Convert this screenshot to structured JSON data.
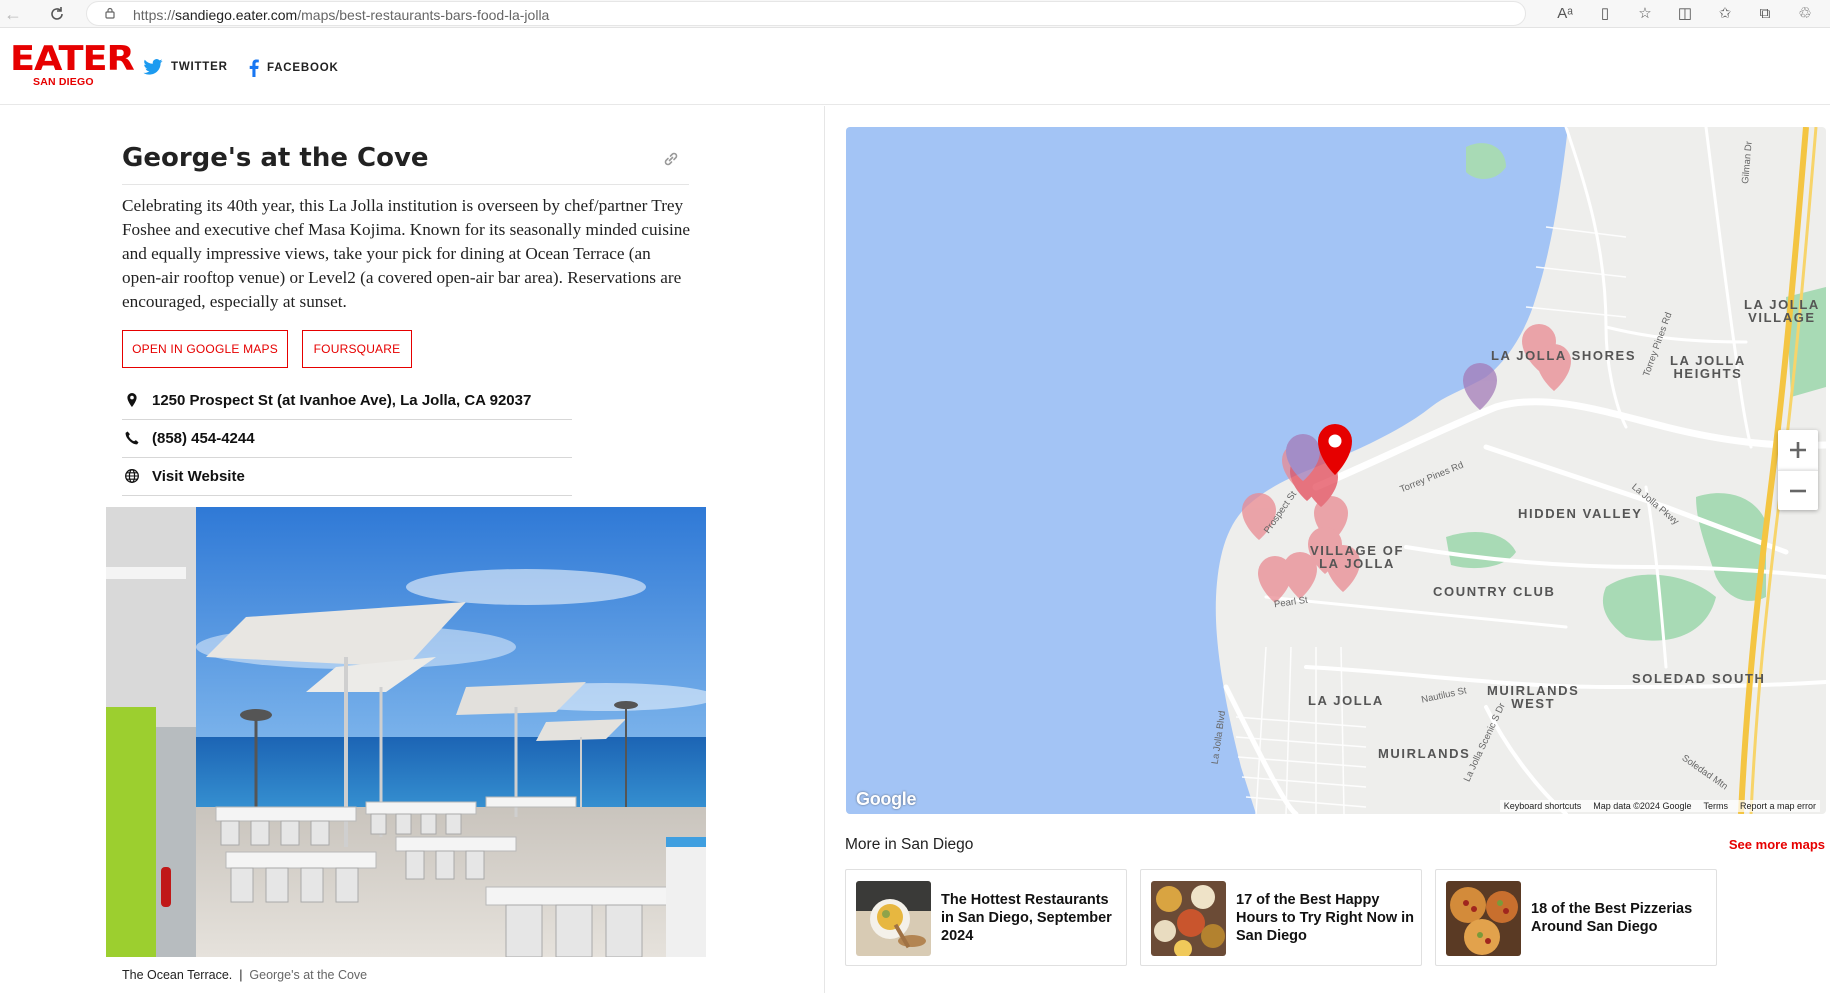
{
  "browser": {
    "url_host": "sandiego.eater.com",
    "url_path": "/maps/best-restaurants-bars-food-la-jolla",
    "url_scheme": "https://"
  },
  "header": {
    "logo": "EATER",
    "city": "SAN DIEGO",
    "twitter_label": "TWITTER",
    "facebook_label": "FACEBOOK"
  },
  "venue": {
    "title": "George's at the Cove",
    "description": "Celebrating its 40th year, this La Jolla institution is overseen by chef/partner Trey Foshee and executive chef Masa Kojima. Known for its seasonally minded cuisine and equally impressive views, take your pick for dining at Ocean Terrace (an open-air rooftop venue) or Level2 (a covered open-air bar area). Reservations are encouraged, especially at sunset.",
    "buttons": {
      "google_maps": "OPEN IN GOOGLE MAPS",
      "foursquare": "FOURSQUARE"
    },
    "address": "1250 Prospect St (at Ivanhoe Ave), La Jolla, CA 92037",
    "phone": "(858) 454-4244",
    "website_label": "Visit Website",
    "photo_caption": "The Ocean Terrace.",
    "photo_credit": "George's at the Cove"
  },
  "map": {
    "labels": {
      "la_jolla_village": "LA JOLLA\nVILLAGE",
      "la_jolla_shores": "LA JOLLA SHORES",
      "la_jolla_heights": "LA JOLLA\nHEIGHTS",
      "hidden_valley": "HIDDEN VALLEY",
      "village_of_la_jolla": "VILLAGE OF\nLA JOLLA",
      "country_club": "COUNTRY CLUB",
      "soledad_south": "SOLEDAD SOUTH",
      "muirlands_west": "MUIRLANDS\nWEST",
      "la_jolla": "LA JOLLA",
      "muirlands": "MUIRLANDS"
    },
    "streets": {
      "torrey_pines_rd": "Torrey Pines Rd",
      "torrey_pines_rd_2": "Torrey Pines Rd",
      "la_jolla_pkwy": "La Jolla Pkwy",
      "prospect_st": "Prospect St",
      "pearl_st": "Pearl St",
      "nautilus_st": "Nautilus St",
      "la_jolla_blvd": "La Jolla Blvd",
      "la_jolla_scenic_s_dr": "La Jolla Scenic S Dr",
      "gilman_dr": "Gilman Dr",
      "soledad_mtn": "Soledad Mtn"
    },
    "brand": "Google",
    "footer": {
      "shortcuts": "Keyboard shortcuts",
      "data": "Map data ©2024 Google",
      "terms": "Terms",
      "report": "Report a map error"
    }
  },
  "more": {
    "heading": "More in San Diego",
    "see_more": "See more maps",
    "cards": [
      {
        "title": "The Hottest Restaurants in San Diego, September 2024"
      },
      {
        "title": "17 of the Best Happy Hours to Try Right Now in San Diego"
      },
      {
        "title": "18 of the Best Pizzerias Around San Diego"
      }
    ]
  },
  "colors": {
    "brand_red": "#e60000",
    "water": "#a3c4f5",
    "park": "#a8dab5"
  }
}
